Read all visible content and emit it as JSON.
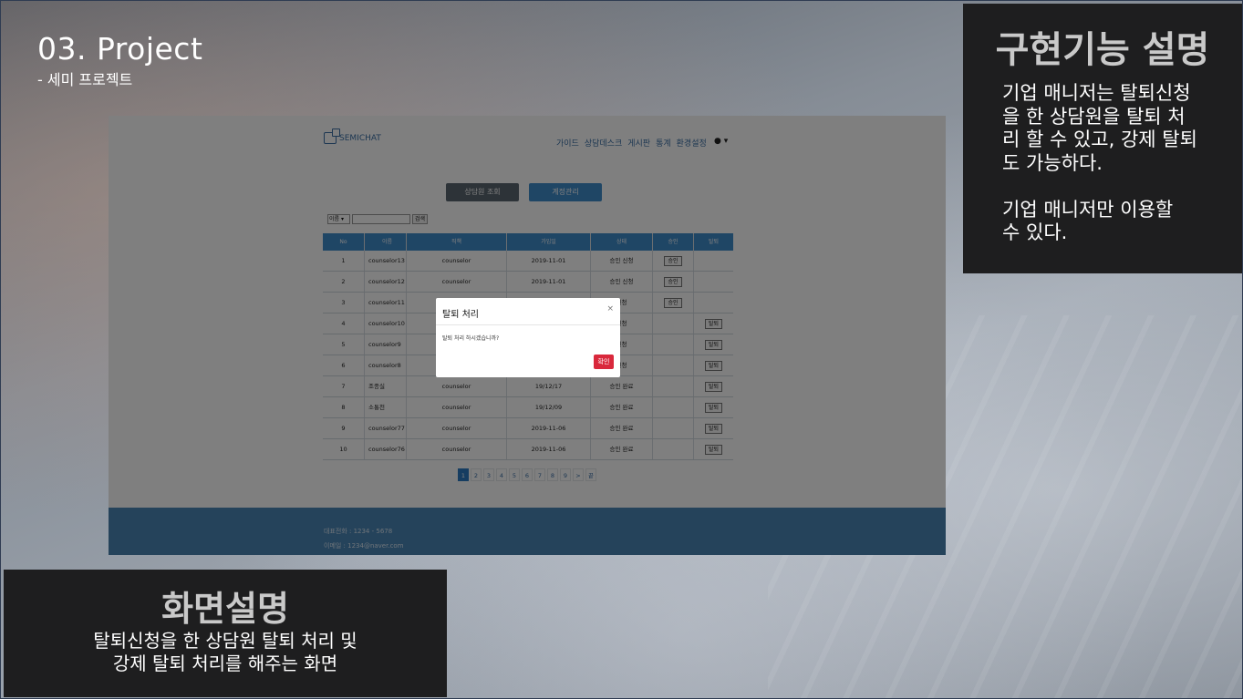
{
  "slide": {
    "title": "03. Project",
    "subtitle": "- 세미 프로젝트"
  },
  "right_panel": {
    "title": "구현기능 설명",
    "body": "기업 매니저는 탈퇴신청\n을 한 상담원을 탈퇴 처\n리 할 수 있고, 강제 탈퇴\n도 가능하다.\n\n기업 매니저만 이용할\n수 있다."
  },
  "left_panel": {
    "title": "화면설명",
    "body": "탈퇴신청을 한 상담원 탈퇴 처리 및\n강제 탈퇴 처리를 해주는 화면"
  },
  "app": {
    "logo_text": "SEMICHAT",
    "nav": [
      "가이드",
      "상담데스크",
      "게시판",
      "통계",
      "환경설정"
    ],
    "user_caret": "▾",
    "tabs": [
      "상담원 조회",
      "계정관리"
    ],
    "search": {
      "select_value": "이름 ▾",
      "button_label": "검색"
    },
    "table": {
      "headers": [
        "No",
        "이름",
        "직책",
        "가입일",
        "상태",
        "승인",
        "탈퇴"
      ],
      "rows": [
        {
          "no": "1",
          "name": "counselor13",
          "pos": "counselor",
          "date": "2019-11-01",
          "status": "승인 신청",
          "approve": "승인",
          "withdraw": ""
        },
        {
          "no": "2",
          "name": "counselor12",
          "pos": "counselor",
          "date": "2019-11-01",
          "status": "승인 신청",
          "approve": "승인",
          "withdraw": ""
        },
        {
          "no": "3",
          "name": "counselor11",
          "pos": "",
          "date": "",
          "status": "신청",
          "approve": "승인",
          "withdraw": ""
        },
        {
          "no": "4",
          "name": "counselor10",
          "pos": "",
          "date": "",
          "status": "신청",
          "approve": "",
          "withdraw": "탈퇴"
        },
        {
          "no": "5",
          "name": "counselor9",
          "pos": "",
          "date": "",
          "status": "신청",
          "approve": "",
          "withdraw": "탈퇴"
        },
        {
          "no": "6",
          "name": "counselor8",
          "pos": "",
          "date": "",
          "status": "신청",
          "approve": "",
          "withdraw": "탈퇴"
        },
        {
          "no": "7",
          "name": "조종실",
          "pos": "counselor",
          "date": "19/12/17",
          "status": "승인 완료",
          "approve": "",
          "withdraw": "탈퇴"
        },
        {
          "no": "8",
          "name": "소통천",
          "pos": "counselor",
          "date": "19/12/09",
          "status": "승인 완료",
          "approve": "",
          "withdraw": "탈퇴"
        },
        {
          "no": "9",
          "name": "counselor77",
          "pos": "counselor",
          "date": "2019-11-06",
          "status": "승인 완료",
          "approve": "",
          "withdraw": "탈퇴"
        },
        {
          "no": "10",
          "name": "counselor76",
          "pos": "counselor",
          "date": "2019-11-06",
          "status": "승인 완료",
          "approve": "",
          "withdraw": "탈퇴"
        }
      ]
    },
    "pagination": [
      "1",
      "2",
      "3",
      "4",
      "5",
      "6",
      "7",
      "8",
      "9",
      ">",
      "끝"
    ],
    "footer": {
      "phone": "대표전화 : 1234 - 5678",
      "email": "이메일 : 1234@naver.com"
    },
    "modal": {
      "title": "탈퇴 처리",
      "close": "×",
      "message": "탈퇴 처리 하시겠습니까?",
      "ok_label": "확인"
    }
  }
}
